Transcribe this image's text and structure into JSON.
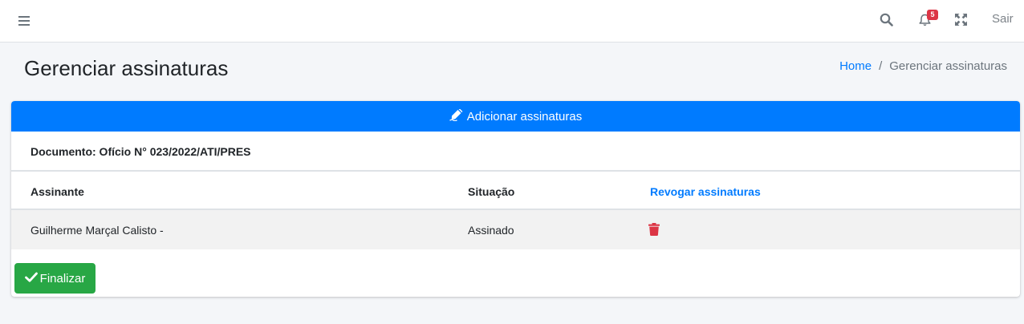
{
  "header": {
    "menu_icon": "hamburger-icon",
    "search_icon": "search-icon",
    "bell_icon": "bell-icon",
    "notification_count": "5",
    "expand_icon": "expand-icon",
    "logout_label": "Sair"
  },
  "page": {
    "title": "Gerenciar assinaturas",
    "breadcrumb": {
      "home": "Home",
      "separator": "/",
      "current": "Gerenciar assinaturas"
    }
  },
  "card": {
    "add_button_label": "Adicionar assinaturas",
    "add_button_icon": "signature-icon",
    "document_line": "Documento: Ofício N° 023/2022/ATI/PRES",
    "table": {
      "headers": {
        "signer": "Assinante",
        "status": "Situação",
        "revoke": "Revogar assinaturas"
      },
      "rows": [
        {
          "signer": "Guilherme Marçal Calisto -",
          "status": "Assinado",
          "action_icon": "trash-icon"
        }
      ]
    },
    "finish_button_label": "Finalizar",
    "finish_button_icon": "check-icon"
  },
  "colors": {
    "primary": "#007bff",
    "success": "#28a745",
    "danger": "#dc3545",
    "background": "#f4f6f9"
  }
}
